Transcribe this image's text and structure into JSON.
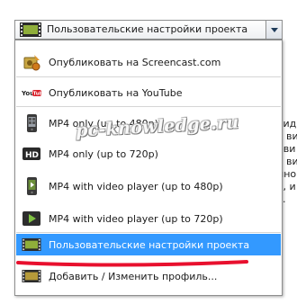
{
  "combo": {
    "selected": "Пользовательские настройки проекта"
  },
  "menu": {
    "items": [
      {
        "label": "Опубликовать на Screencast.com",
        "icon": "screencast-icon"
      },
      {
        "label": "Опубликовать на YouTube",
        "icon": "youtube-icon"
      },
      {
        "label": "MP4 only (up to 480p)",
        "icon": "mp4-phone-icon"
      },
      {
        "label": "MP4 only (up to 720p)",
        "icon": "hd-icon"
      },
      {
        "label": "MP4 with video player (up to 480p)",
        "icon": "play-phone-icon"
      },
      {
        "label": "MP4 with video player (up to 720p)",
        "icon": "play-icon"
      },
      {
        "label": "Пользовательские настройки проекта",
        "icon": "film-icon"
      },
      {
        "label": "Добавить / Изменить профиль...",
        "icon": "film-icon"
      }
    ]
  },
  "background_text": [
    "вид",
    "ь ви",
    "ови",
    "ь ви",
    "нно",
    "ь, и",
    "с."
  ],
  "watermark": "pc-knowledge.ru",
  "colors": {
    "selection": "#3399ff",
    "underline": "#e8102e"
  }
}
